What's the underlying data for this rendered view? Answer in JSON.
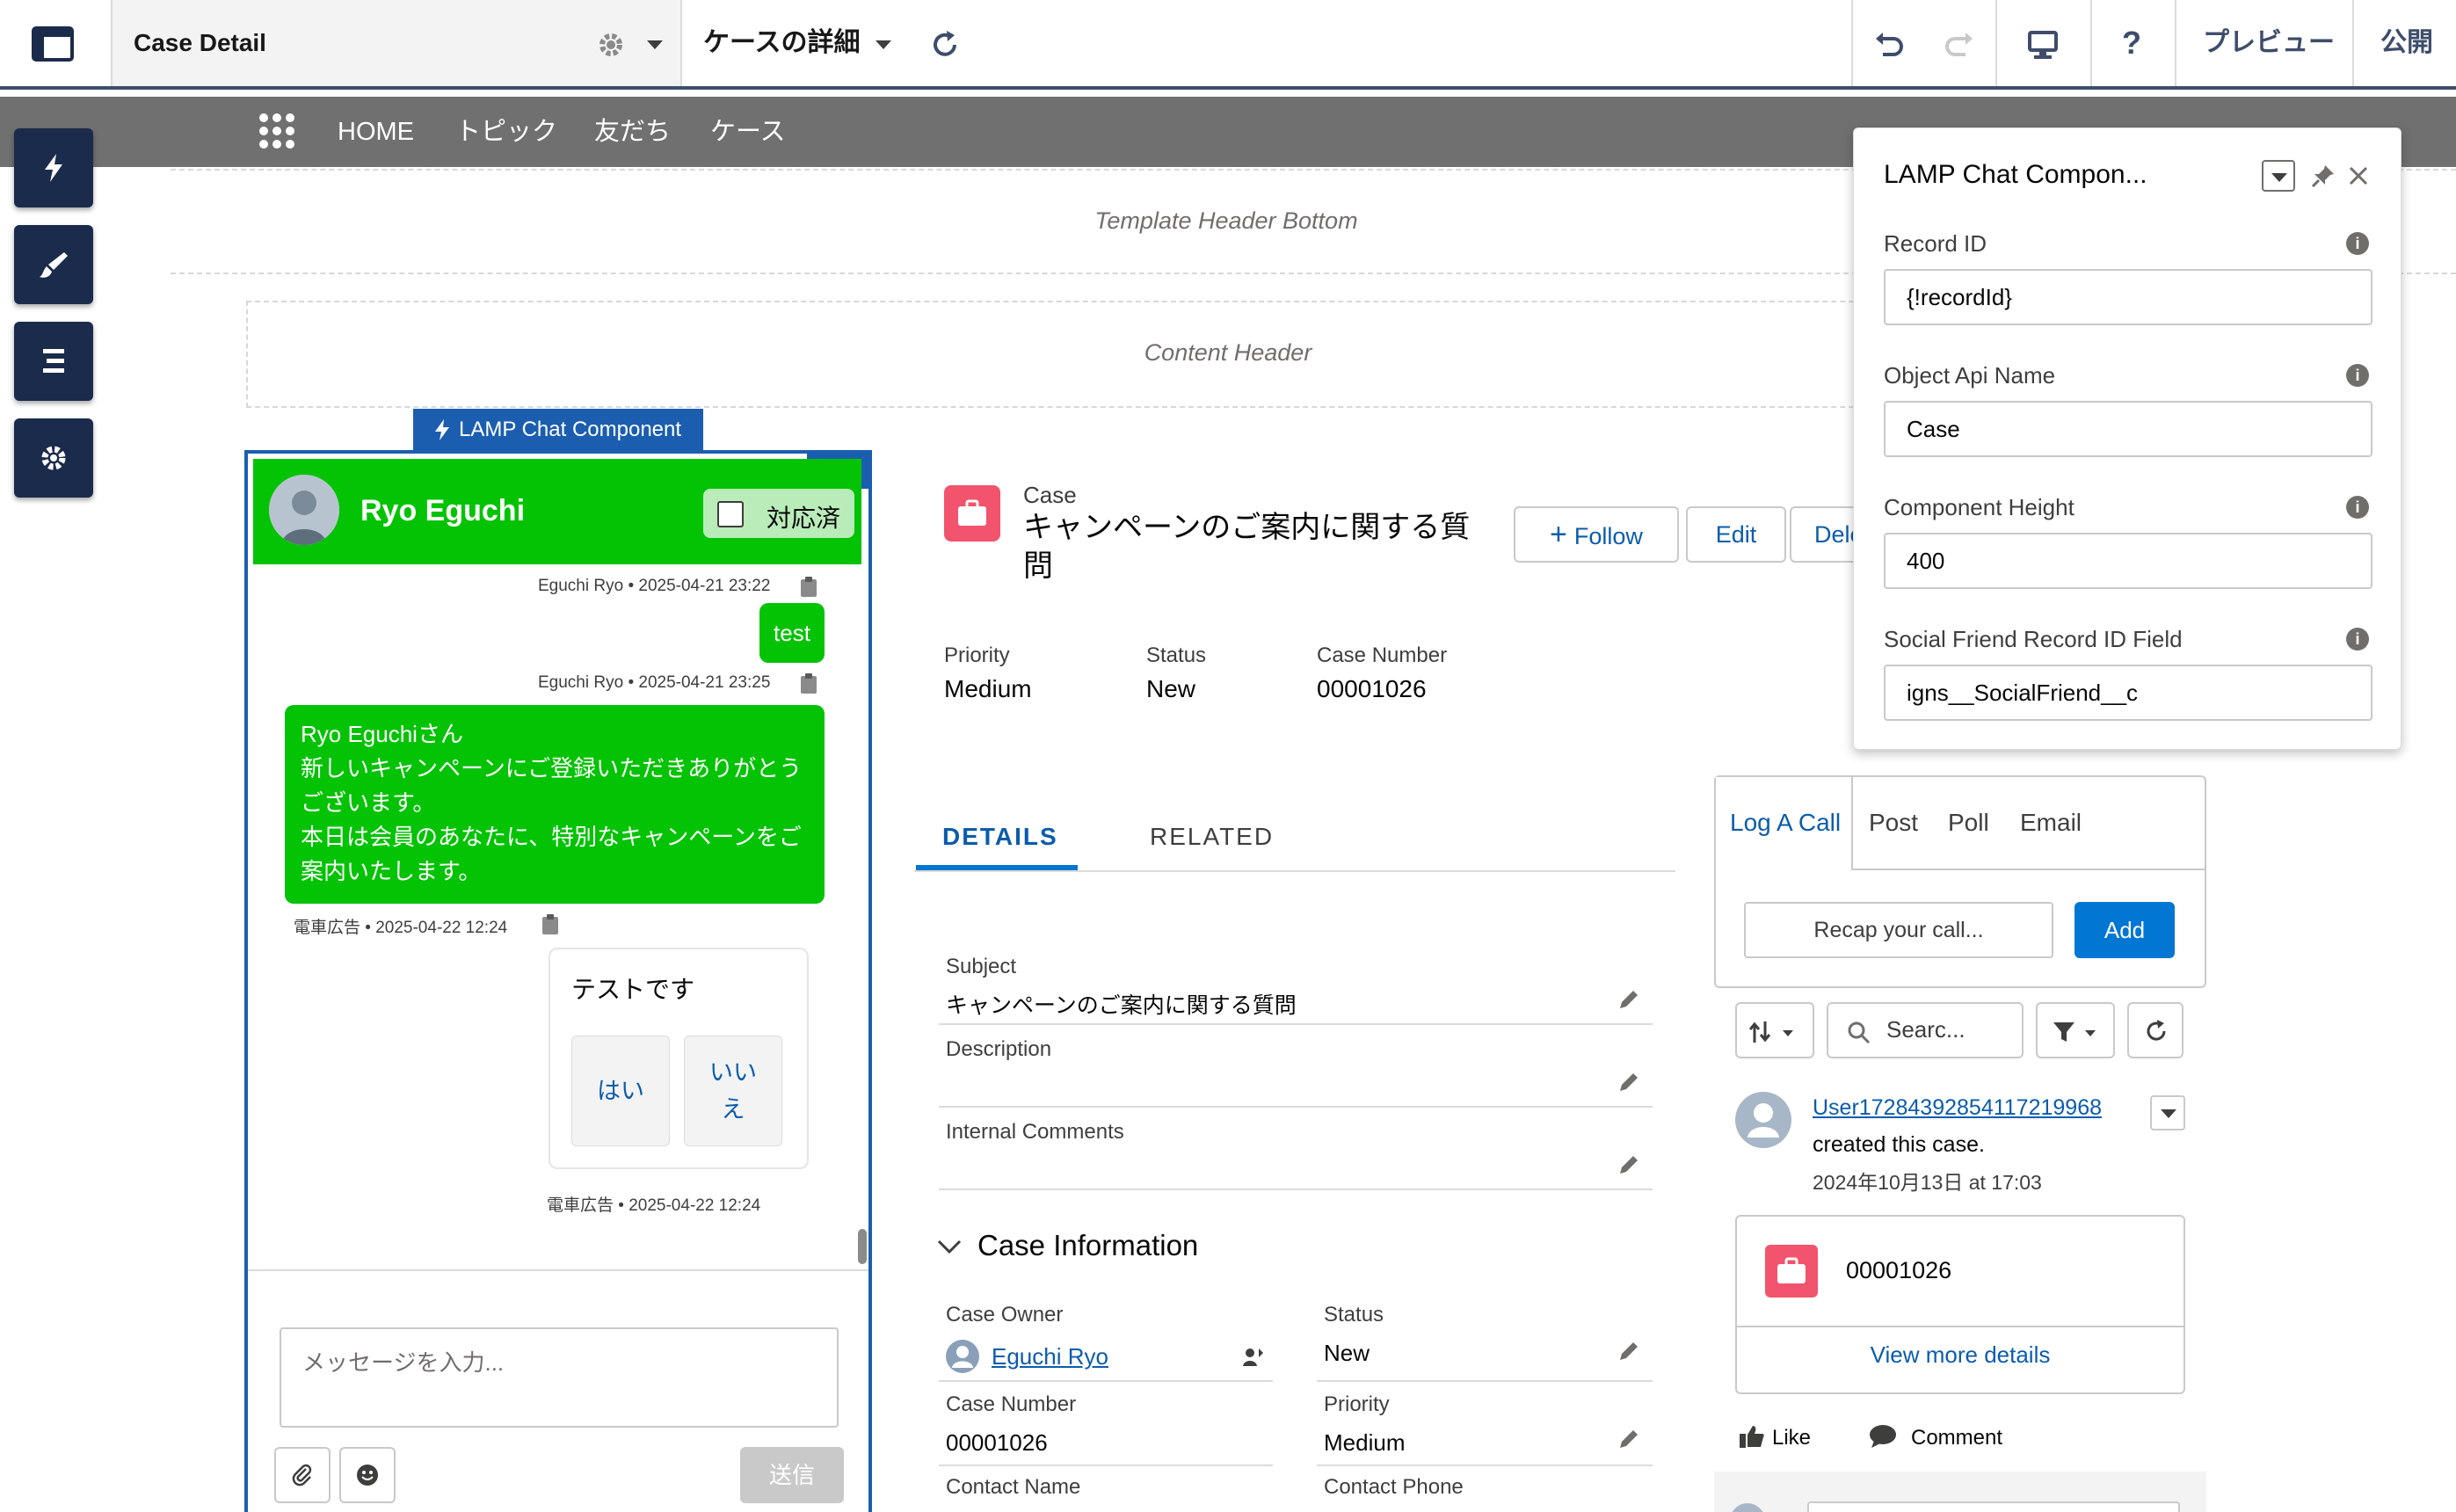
{
  "topbar": {
    "page_name": "Case Detail",
    "page_variant": "ケースの詳細",
    "preview": "プレビュー",
    "publish": "公開"
  },
  "nav": {
    "items": [
      "HOME",
      "トピック",
      "友だち",
      "ケース"
    ]
  },
  "template": {
    "header_bottom": "Template Header Bottom",
    "content_header": "Content Header"
  },
  "chat": {
    "component_label": "LAMP Chat Component",
    "user_name": "Ryo Eguchi",
    "resolved_label": "対応済",
    "messages": [
      {
        "meta": "Eguchi Ryo • 2025-04-21 23:22"
      },
      {
        "text": "test",
        "meta": "Eguchi Ryo • 2025-04-21 23:25"
      },
      {
        "lines": [
          "Ryo Eguchiさん",
          "新しいキャンペーンにご登録いただきありがとう",
          "ございます。",
          "本日は会員のあなたに、特別なキャンペーンをご",
          "案内いたします。"
        ],
        "meta": "電車広告 • 2025-04-22 12:24"
      },
      {
        "title": "テストです",
        "option_yes": "はい",
        "option_no_1": "いい",
        "option_no_2": "え",
        "meta": "電車広告 • 2025-04-22 12:24"
      }
    ],
    "input_placeholder": "メッセージを入力...",
    "send_label": "送信"
  },
  "record": {
    "object_label": "Case",
    "title_line1": "キャンペーンのご案内に関する質",
    "title_line2": "問",
    "follow": "Follow",
    "edit": "Edit",
    "delete_partial": "Dele",
    "highlights": [
      {
        "label": "Priority",
        "value": "Medium"
      },
      {
        "label": "Status",
        "value": "New"
      },
      {
        "label": "Case Number",
        "value": "00001026"
      }
    ],
    "tabs": [
      "DETAILS",
      "RELATED"
    ],
    "subject_label": "Subject",
    "subject_value": "キャンペーンのご案内に関する質問",
    "description_label": "Description",
    "internal_comments_label": "Internal Comments",
    "section_title": "Case Information",
    "case_owner_label": "Case Owner",
    "case_owner_value": "Eguchi Ryo",
    "status_label": "Status",
    "status_value": "New",
    "case_number_label": "Case Number",
    "case_number_value": "00001026",
    "priority_label": "Priority",
    "priority_value": "Medium",
    "contact_name_label": "Contact Name",
    "contact_phone_label": "Contact Phone"
  },
  "feed": {
    "tabs": [
      "Log A Call",
      "Post",
      "Poll",
      "Email"
    ],
    "recap_placeholder": "Recap your call...",
    "add": "Add",
    "search_placeholder": "Searc...",
    "item_user": "User17284392854117219968",
    "item_action": "created this case.",
    "item_time": "2024年10月13日 at 17:03",
    "card_number": "00001026",
    "view_more": "View more details",
    "like": "Like",
    "comment": "Comment"
  },
  "panel": {
    "title": "LAMP Chat Compon...",
    "fields": [
      {
        "label": "Record ID",
        "value": "{!recordId}"
      },
      {
        "label": "Object Api Name",
        "value": "Case"
      },
      {
        "label": "Component Height",
        "value": "400"
      },
      {
        "label": "Social Friend Record ID Field",
        "value": "igns__SocialFriend__c"
      }
    ]
  },
  "colors": {
    "builder_navy": "#1b2b4b",
    "chat_green": "#04c304",
    "brand_blue": "#0176d3",
    "case_pink": "#f2536d"
  }
}
